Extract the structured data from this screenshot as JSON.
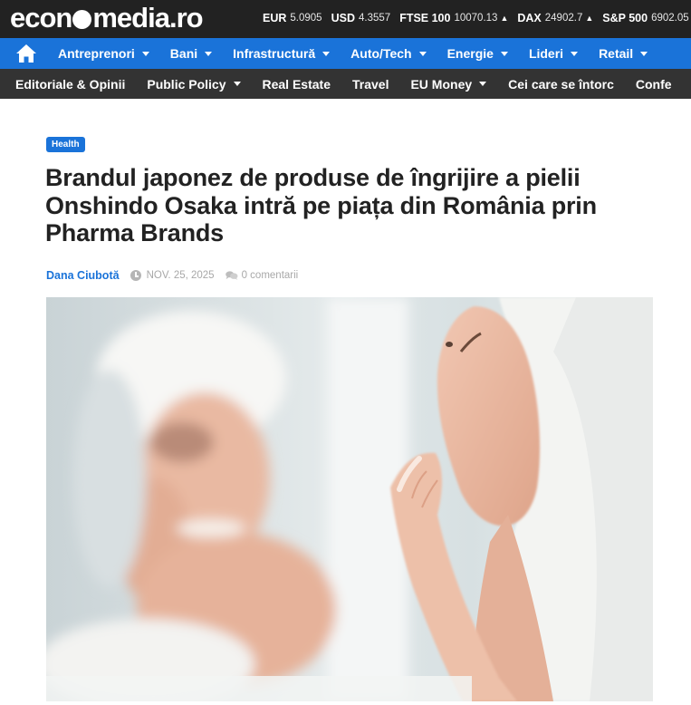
{
  "site": {
    "logo_prefix": "econ",
    "logo_suffix": "media.ro"
  },
  "ticker": [
    {
      "name": "EUR",
      "value": "5.0905",
      "arrow": ""
    },
    {
      "name": "USD",
      "value": "4.3557",
      "arrow": ""
    },
    {
      "name": "FTSE 100",
      "value": "10070.13",
      "arrow": "▲"
    },
    {
      "name": "DAX",
      "value": "24902.7",
      "arrow": "▲"
    },
    {
      "name": "S&P 500",
      "value": "6902.05",
      "arrow": "▲"
    }
  ],
  "primary_nav": [
    {
      "label": "Antreprenori"
    },
    {
      "label": "Bani"
    },
    {
      "label": "Infrastructură"
    },
    {
      "label": "Auto/Tech"
    },
    {
      "label": "Energie"
    },
    {
      "label": "Lideri"
    },
    {
      "label": "Retail"
    }
  ],
  "secondary_nav": [
    {
      "label": "Editoriale & Opinii"
    },
    {
      "label": "Public Policy"
    },
    {
      "label": "Real Estate"
    },
    {
      "label": "Travel"
    },
    {
      "label": "EU Money"
    },
    {
      "label": "Cei care se întorc"
    },
    {
      "label": "Confe"
    }
  ],
  "article": {
    "category": "Health",
    "title": "Brandul japonez de produse de îngrijire a pielii Onshindo Osaka intră pe piața din România prin Pharma Brands",
    "author": "Dana Ciubotă",
    "date": "NOV. 25, 2025",
    "comments": "0 comentarii"
  },
  "icons": {
    "home": "home-icon",
    "clock": "clock-icon",
    "comments": "comments-icon",
    "caret": "chevron-down-icon"
  },
  "colors": {
    "brand_blue": "#1a73d9",
    "topbar": "#222222",
    "secondary_nav": "#333333"
  }
}
